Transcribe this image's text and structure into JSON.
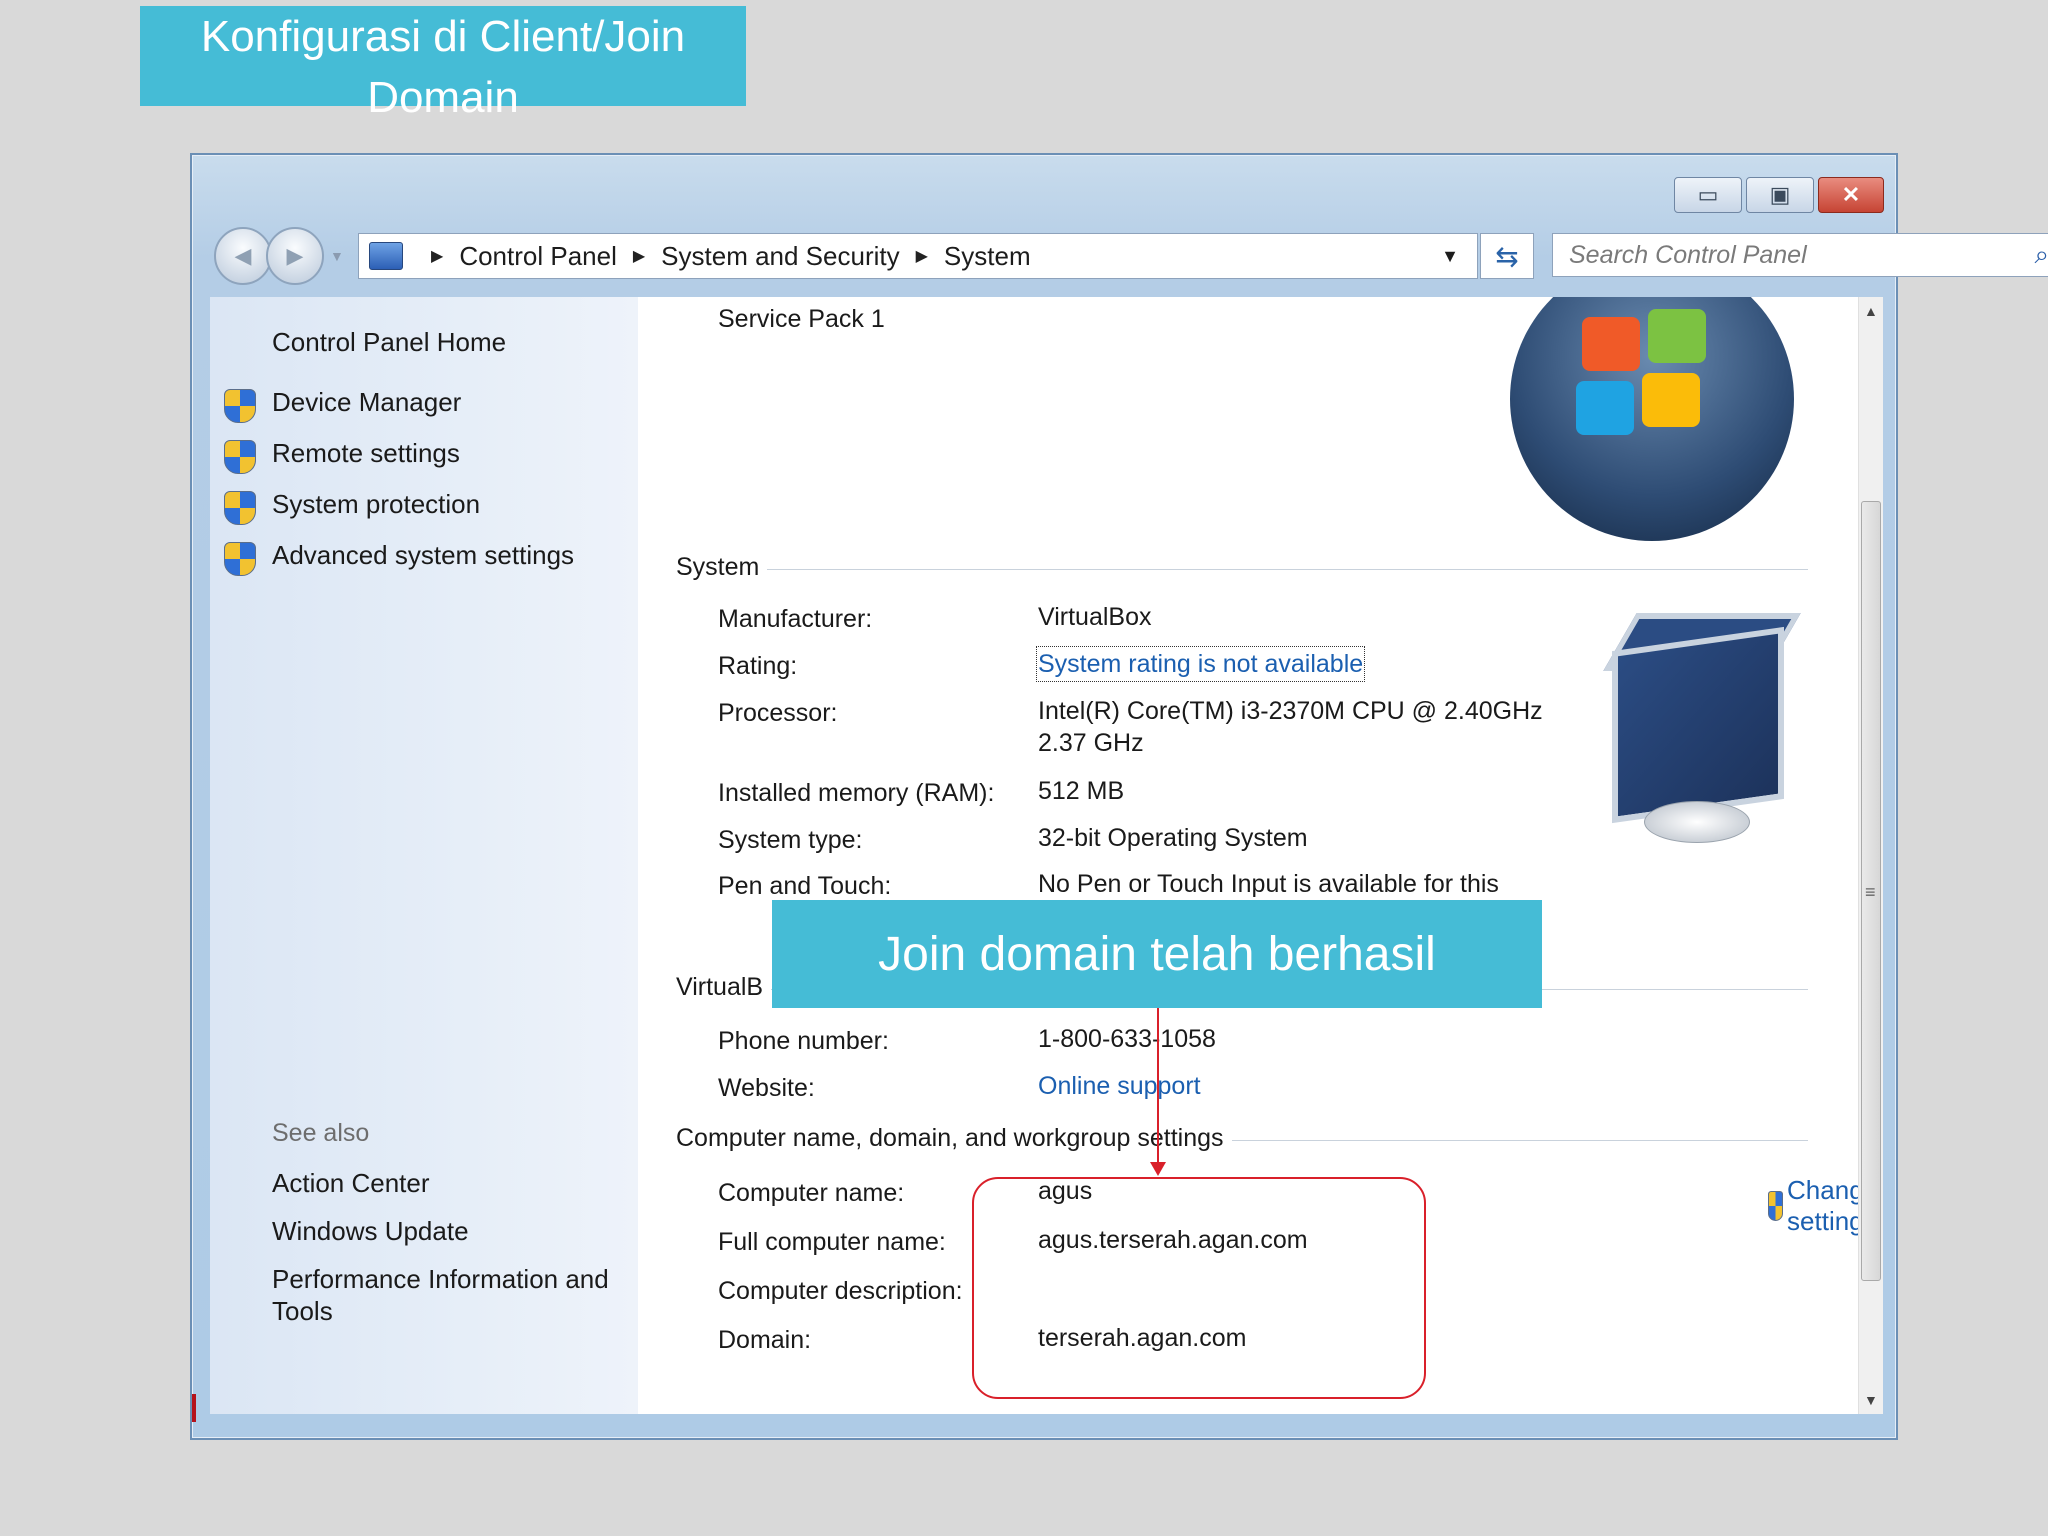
{
  "slide": {
    "title_line1": "Konfigurasi di Client/Join",
    "title_line2": "Domain",
    "callout": "Join domain telah berhasil"
  },
  "window": {
    "caption": {
      "minimize": "▭",
      "maximize": "▣",
      "close": "✕"
    },
    "breadcrumb": [
      "Control Panel",
      "System and Security",
      "System"
    ],
    "search_placeholder": "Search Control Panel"
  },
  "sidebar": {
    "home": "Control Panel Home",
    "links": [
      "Device Manager",
      "Remote settings",
      "System protection",
      "Advanced system settings"
    ],
    "see_also_label": "See also",
    "see_also": [
      "Action Center",
      "Windows Update",
      "Performance Information and Tools"
    ]
  },
  "content": {
    "service_pack": "Service Pack 1",
    "system": {
      "heading": "System",
      "manufacturer_label": "Manufacturer:",
      "manufacturer": "VirtualBox",
      "rating_label": "Rating:",
      "rating": "System rating is not available",
      "processor_label": "Processor:",
      "processor_line1": "Intel(R) Core(TM) i3-2370M CPU @ 2.40GHz",
      "processor_line2": "2.37 GHz",
      "ram_label": "Installed memory (RAM):",
      "ram": "512 MB",
      "type_label": "System type:",
      "type": "32-bit Operating System",
      "pen_label": "Pen and Touch:",
      "pen": "No Pen or Touch Input is available for this"
    },
    "support": {
      "heading": "VirtualB",
      "phone_label": "Phone number:",
      "phone": "1-800-633-1058",
      "website_label": "Website:",
      "website": "Online support"
    },
    "computer": {
      "heading": "Computer name, domain, and workgroup settings",
      "name_label": "Computer name:",
      "name": "agus",
      "full_label": "Full computer name:",
      "full": "agus.terserah.agan.com",
      "desc_label": "Computer description:",
      "domain_label": "Domain:",
      "domain": "terserah.agan.com",
      "change_settings": "Change settings"
    }
  },
  "colors": {
    "accent": "#45bcd6",
    "highlight": "#d9202a",
    "link": "#1b5fb0"
  }
}
